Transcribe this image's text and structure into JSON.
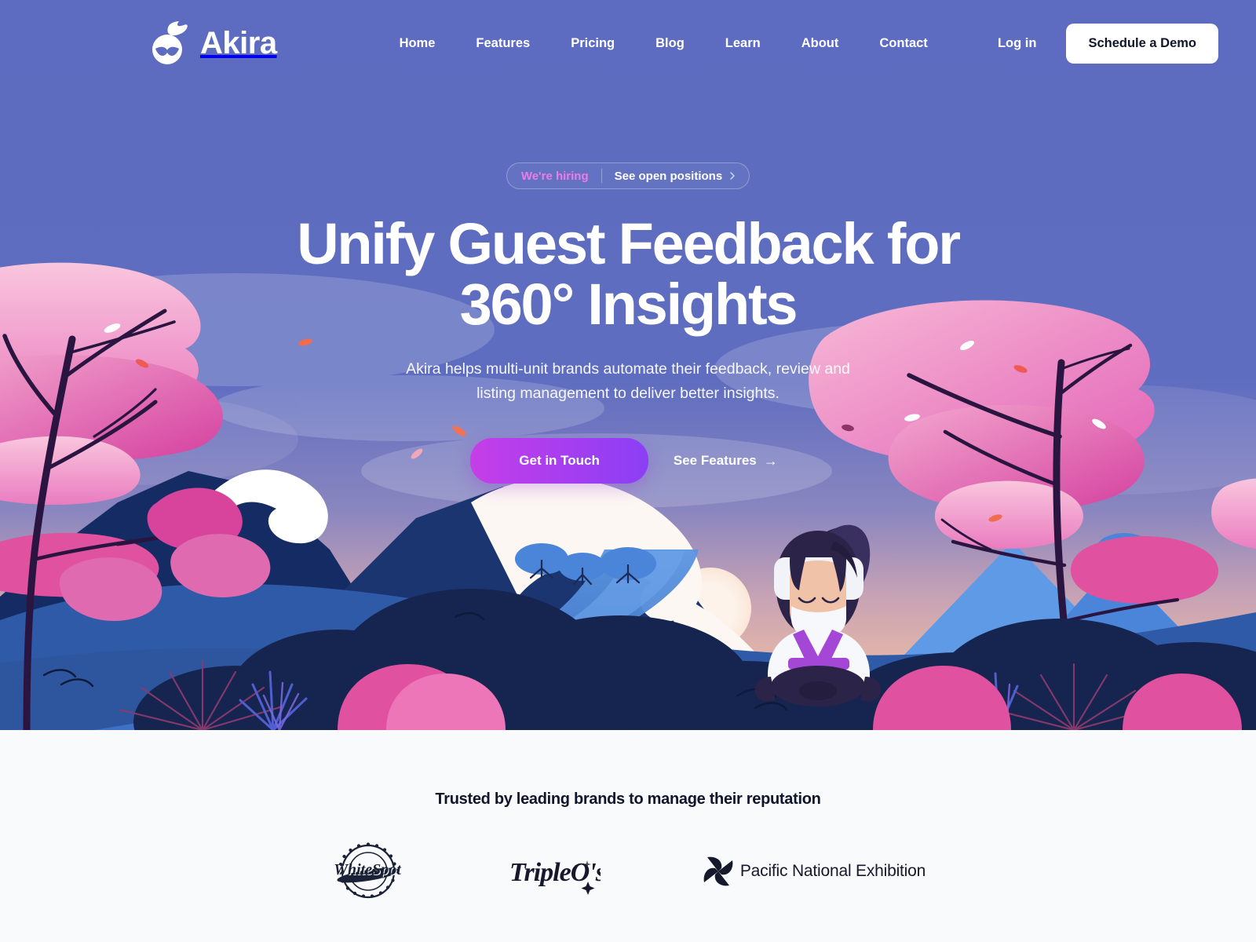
{
  "brand": {
    "name": "Akira",
    "logo_icon": "ninja-mask-logo-icon"
  },
  "nav": {
    "links": [
      {
        "label": "Home"
      },
      {
        "label": "Features"
      },
      {
        "label": "Pricing"
      },
      {
        "label": "Blog"
      },
      {
        "label": "Learn"
      },
      {
        "label": "About"
      },
      {
        "label": "Contact"
      }
    ],
    "login_label": "Log in",
    "demo_label": "Schedule a Demo"
  },
  "hero": {
    "announcement": {
      "badge_label": "We're hiring",
      "link_label": "See open positions",
      "chevron_icon": "chevron-right-icon",
      "badge_color": "#ec7ce8"
    },
    "headline": "Unify Guest Feedback for 360° Insights",
    "subheadline": "Akira helps multi-unit brands automate their feedback, review and listing management to deliver better insights.",
    "primary_cta": "Get in Touch",
    "secondary_cta": "See Features",
    "secondary_cta_icon": "arrow-right-icon",
    "background_color": "#5d6cc0",
    "primary_cta_gradient": [
      "#c63ee8",
      "#8b3ff5"
    ],
    "illustration": "japanese-sunset-landscape-with-meditating-ninja"
  },
  "brands": {
    "title": "Trusted by leading brands to manage their reputation",
    "logos": [
      {
        "name": "White Spot",
        "icon": "whitespot-logo-icon"
      },
      {
        "name": "Triple O's",
        "icon": "tripleos-logo-icon"
      },
      {
        "name": "Pacific National Exhibition",
        "icon": "pne-pinwheel-icon"
      }
    ]
  }
}
